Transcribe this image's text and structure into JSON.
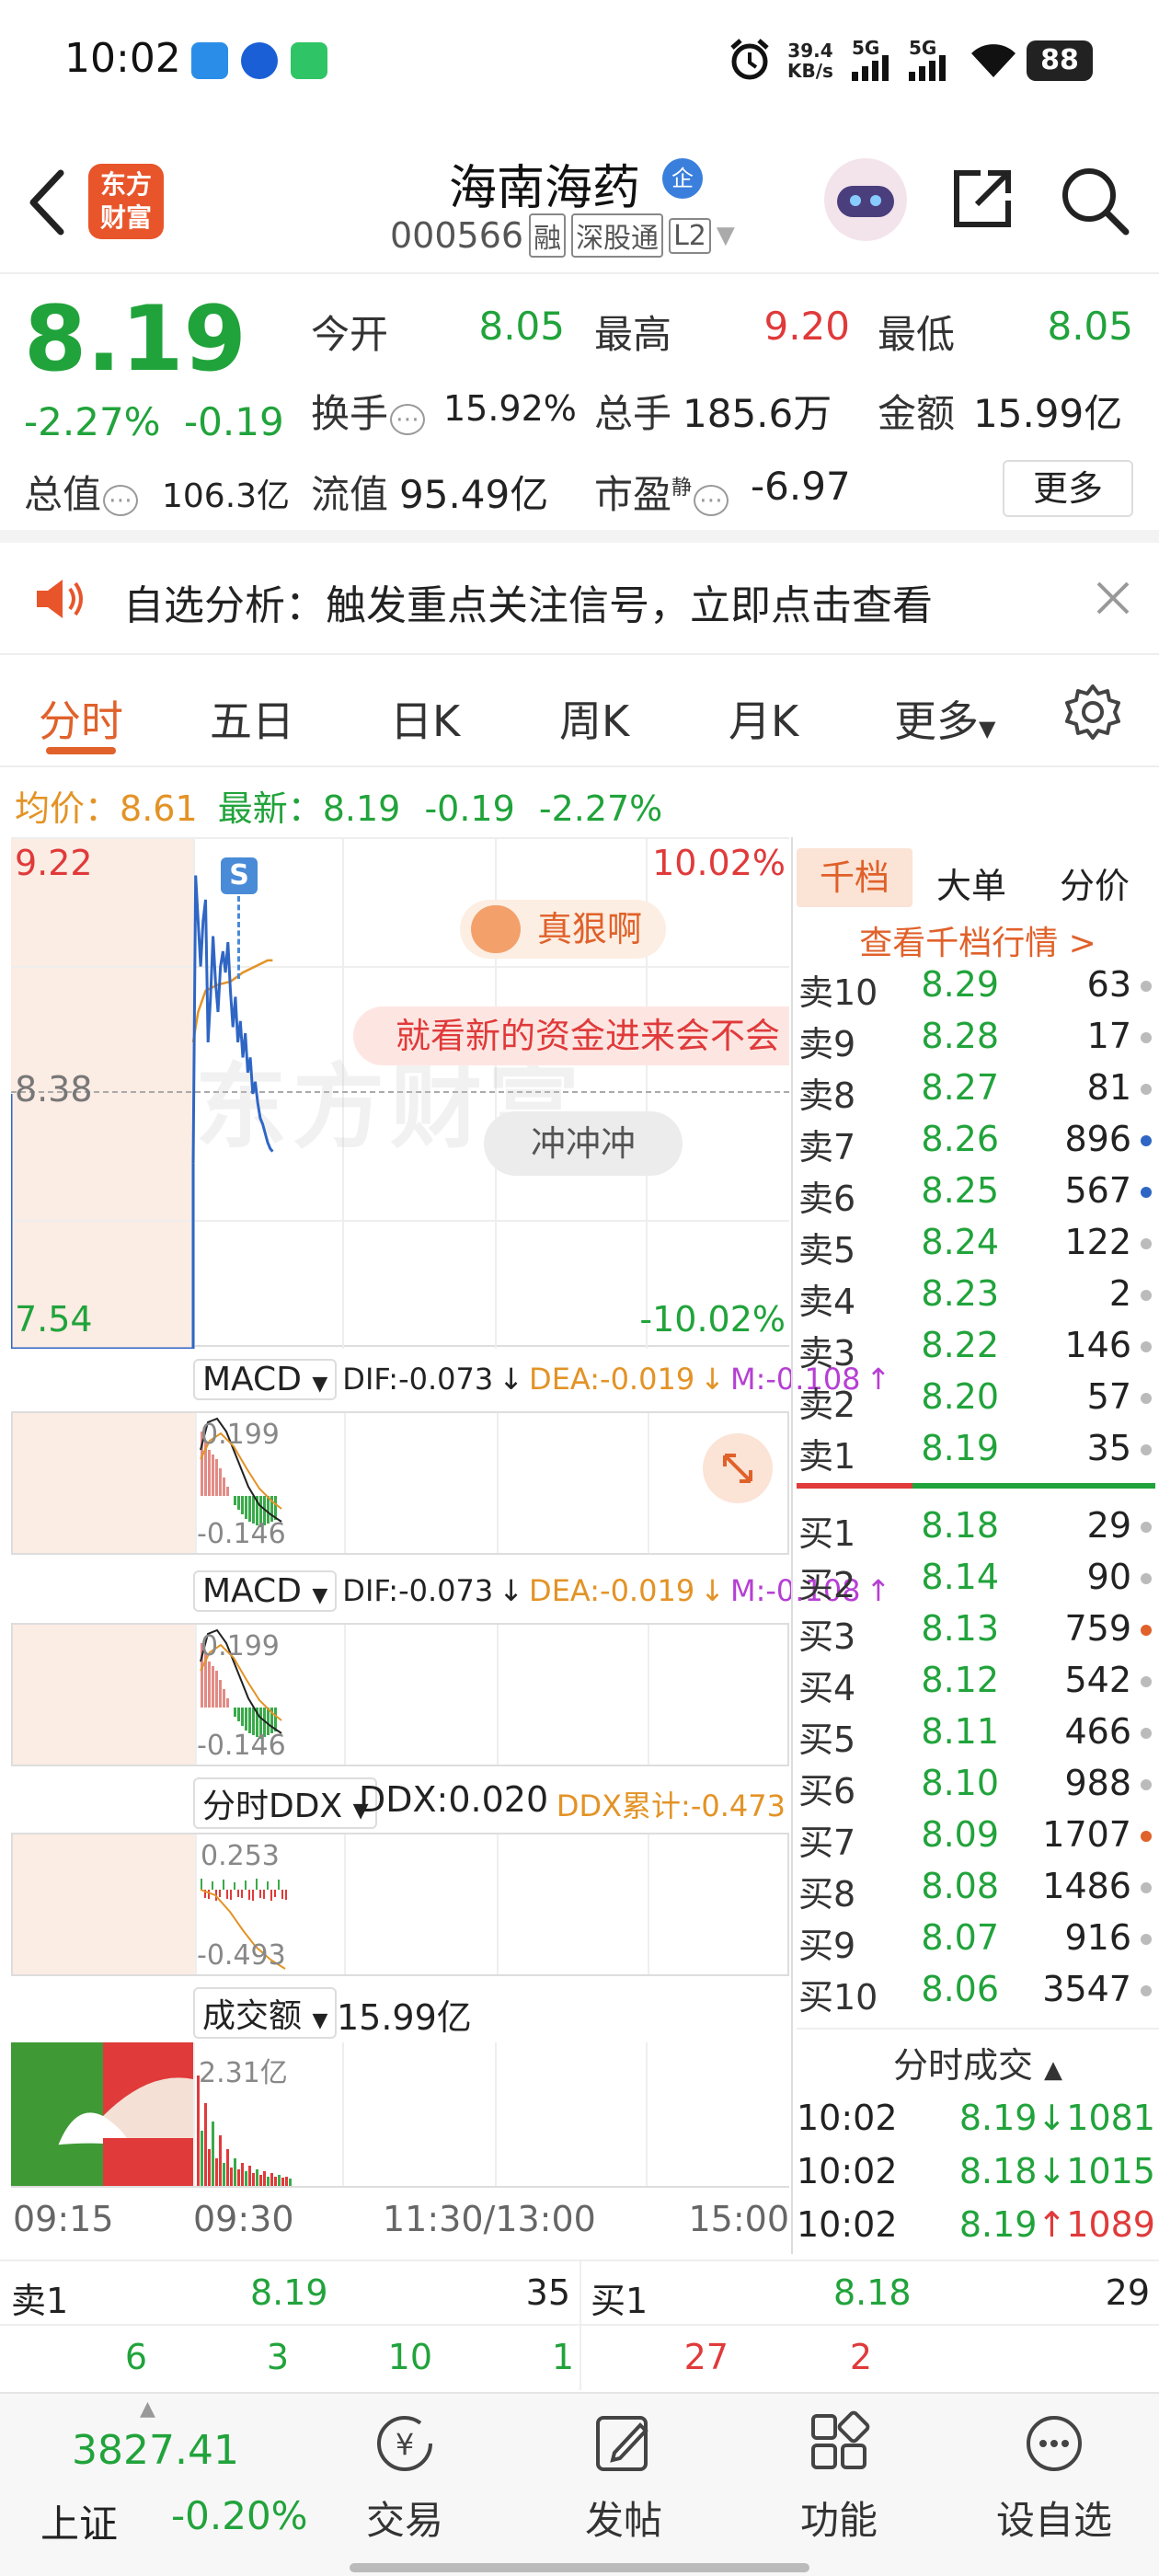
{
  "status_bar": {
    "time": "10:02",
    "net_speed_value": "39.4",
    "net_speed_unit": "KB/s",
    "signal1": "5G",
    "signal2": "5G",
    "battery": "88"
  },
  "header": {
    "logo_line1": "东方",
    "logo_line2": "财富",
    "stock_name": "海南海药",
    "stock_code": "000566",
    "tag_margin": "融",
    "tag_connect": "深股通",
    "tag_level": "L2"
  },
  "quote": {
    "price": "8.19",
    "change_pct": "-2.27%",
    "change": "-0.19",
    "open_label": "今开",
    "open": "8.05",
    "high_label": "最高",
    "high": "9.20",
    "low_label": "最低",
    "low": "8.05",
    "turnover_label": "换手",
    "turnover": "15.92%",
    "volume_label": "总手",
    "volume": "185.6万",
    "amount_label": "金额",
    "amount": "15.99亿",
    "mktcap_label": "总值",
    "mktcap": "106.3亿",
    "float_label": "流值",
    "float": "95.49亿",
    "pe_label": "市盈",
    "pe_sup": "静",
    "pe": "-6.97",
    "more_button": "更多"
  },
  "notice": {
    "text": "自选分析：触发重点关注信号，立即点击查看"
  },
  "tabs": [
    {
      "label": "分时",
      "active": true
    },
    {
      "label": "五日"
    },
    {
      "label": "日K"
    },
    {
      "label": "周K"
    },
    {
      "label": "月K"
    },
    {
      "label": "更多"
    }
  ],
  "intraday": {
    "avg_label": "均价：",
    "avg_value": "8.61",
    "last_label": "最新：",
    "last_value": "8.19",
    "last_change": "-0.19",
    "last_pct": "-2.27%",
    "y_top": "9.22",
    "y_mid": "8.38",
    "y_bottom": "7.54",
    "pct_top": "10.02%",
    "pct_bottom": "-10.02%",
    "signal_badge": "S",
    "bubble1": "真狠啊",
    "bubble2": "就看新的资金进来会不会",
    "bubble3": "冲冲冲",
    "watermark": "东方财富"
  },
  "chart_data": {
    "type": "line",
    "title": "",
    "x_ticks": [
      "09:15",
      "09:30",
      "11:30/13:00",
      "15:00"
    ],
    "ylim": [
      7.54,
      9.22
    ],
    "pre_close": 8.38,
    "series": [
      {
        "name": "",
        "x": [
          "09:30",
          "09:31",
          "09:32",
          "09:33",
          "09:34",
          "09:35",
          "09:36",
          "09:37",
          "09:38",
          "09:39",
          "09:40",
          "09:41",
          "09:42",
          "09:43",
          "09:44",
          "09:45",
          "09:46",
          "09:47",
          "09:48",
          "09:49",
          "09:50",
          "09:51",
          "09:52",
          "09:53",
          "09:54",
          "09:55",
          "09:56",
          "09:57",
          "09:58",
          "09:59",
          "10:00",
          "10:01",
          "10:02"
        ],
        "values": [
          8.15,
          9.1,
          8.95,
          8.8,
          8.95,
          9.02,
          8.55,
          8.7,
          8.9,
          8.75,
          8.65,
          8.8,
          8.85,
          8.78,
          8.88,
          8.72,
          8.6,
          8.7,
          8.55,
          8.62,
          8.5,
          8.58,
          8.45,
          8.5,
          8.38,
          8.42,
          8.35,
          8.3,
          8.28,
          8.25,
          8.22,
          8.2,
          8.19
        ]
      },
      {
        "name": "",
        "x": [
          "09:30",
          "09:32",
          "09:35",
          "09:40",
          "09:45",
          "09:50",
          "09:55",
          "10:00",
          "10:02"
        ],
        "values": [
          8.55,
          8.65,
          8.72,
          8.74,
          8.75,
          8.78,
          8.8,
          8.82,
          8.82
        ]
      }
    ]
  },
  "macd1": {
    "selector": "MACD",
    "dif": "DIF:-0.073",
    "dea": "DEA:-0.019",
    "m": "M:-0.108",
    "top": "0.199",
    "bottom": "-0.146"
  },
  "macd2": {
    "selector": "MACD",
    "dif": "DIF:-0.073",
    "dea": "DEA:-0.019",
    "m": "M:-0.108",
    "top": "0.199",
    "bottom": "-0.146"
  },
  "ddx": {
    "selector": "分时DDX",
    "value": "DDX:0.020",
    "cum": "DDX累计:-0.473",
    "top": "0.253",
    "bottom": "-0.493"
  },
  "turnover_panel": {
    "selector": "成交额",
    "value": "15.99亿",
    "peak": "2.31亿"
  },
  "orderbook": {
    "tab_active": "千档",
    "tab2": "大单",
    "tab3": "分价",
    "link": "查看千档行情 >",
    "asks": [
      {
        "label": "卖10",
        "price": "8.29",
        "vol": "63",
        "dot": "#bbbbbb"
      },
      {
        "label": "卖9",
        "price": "8.28",
        "vol": "17",
        "dot": "#bbbbbb"
      },
      {
        "label": "卖8",
        "price": "8.27",
        "vol": "81",
        "dot": "#bbbbbb"
      },
      {
        "label": "卖7",
        "price": "8.26",
        "vol": "896",
        "dot": "#2f66c4"
      },
      {
        "label": "卖6",
        "price": "8.25",
        "vol": "567",
        "dot": "#2f66c4"
      },
      {
        "label": "卖5",
        "price": "8.24",
        "vol": "122",
        "dot": "#bbbbbb"
      },
      {
        "label": "卖4",
        "price": "8.23",
        "vol": "2",
        "dot": "#bbbbbb"
      },
      {
        "label": "卖3",
        "price": "8.22",
        "vol": "146",
        "dot": "#bbbbbb"
      },
      {
        "label": "卖2",
        "price": "8.20",
        "vol": "57",
        "dot": "#bbbbbb"
      },
      {
        "label": "卖1",
        "price": "8.19",
        "vol": "35",
        "dot": "#bbbbbb"
      }
    ],
    "bids": [
      {
        "label": "买1",
        "price": "8.18",
        "vol": "29",
        "dot": "#bbbbbb"
      },
      {
        "label": "买2",
        "price": "8.14",
        "vol": "90",
        "dot": "#bbbbbb"
      },
      {
        "label": "买3",
        "price": "8.13",
        "vol": "759",
        "dot": "#e0612a"
      },
      {
        "label": "买4",
        "price": "8.12",
        "vol": "542",
        "dot": "#bbbbbb"
      },
      {
        "label": "买5",
        "price": "8.11",
        "vol": "466",
        "dot": "#bbbbbb"
      },
      {
        "label": "买6",
        "price": "8.10",
        "vol": "988",
        "dot": "#bbbbbb"
      },
      {
        "label": "买7",
        "price": "8.09",
        "vol": "1707",
        "dot": "#e0612a"
      },
      {
        "label": "买8",
        "price": "8.08",
        "vol": "1486",
        "dot": "#bbbbbb"
      },
      {
        "label": "买9",
        "price": "8.07",
        "vol": "916",
        "dot": "#bbbbbb"
      },
      {
        "label": "买10",
        "price": "8.06",
        "vol": "3547",
        "dot": "#bbbbbb"
      }
    ],
    "ticks_title": "分时成交",
    "ticks": [
      {
        "time": "10:02",
        "price": "8.19",
        "dir": "↓",
        "vol": "1081",
        "dir_color": "#21a33b"
      },
      {
        "time": "10:02",
        "price": "8.18",
        "dir": "↓",
        "vol": "1015",
        "dir_color": "#21a33b"
      },
      {
        "time": "10:02",
        "price": "8.19",
        "dir": "↑",
        "vol": "1089",
        "dir_color": "#e03a3a"
      }
    ]
  },
  "bottom_bar": {
    "ask_label": "卖1",
    "ask_price": "8.19",
    "ask_vol": "35",
    "bid_label": "买1",
    "bid_price": "8.18",
    "bid_vol": "29",
    "ask_queue": [
      "6",
      "3",
      "10",
      "1"
    ],
    "bid_queue": [
      "27",
      "2"
    ]
  },
  "bottom_nav": {
    "index_value": "3827.41",
    "index_name": "上证",
    "index_change": "-0.20%",
    "items": [
      "交易",
      "发帖",
      "功能",
      "设自选"
    ]
  },
  "colors": {
    "up": "#e03a3a",
    "down": "#21a33b",
    "accent": "#e0612a",
    "avg_line": "#e39326",
    "price_line": "#2f66c4"
  }
}
